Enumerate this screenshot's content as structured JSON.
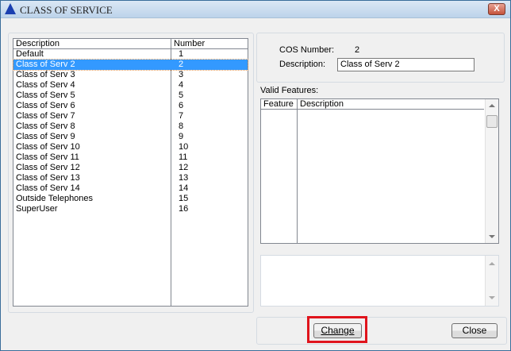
{
  "window": {
    "title": "CLASS OF SERVICE",
    "close_label": "X"
  },
  "cos_list": {
    "columns": [
      "Description",
      "Number"
    ],
    "rows": [
      {
        "description": "Default",
        "number": "1"
      },
      {
        "description": "Class of Serv 2",
        "number": "2",
        "selected": true
      },
      {
        "description": "Class of Serv 3",
        "number": "3"
      },
      {
        "description": "Class of Serv 4",
        "number": "4"
      },
      {
        "description": "Class of Serv 5",
        "number": "5"
      },
      {
        "description": "Class of Serv 6",
        "number": "6"
      },
      {
        "description": "Class of Serv 7",
        "number": "7"
      },
      {
        "description": "Class of Serv 8",
        "number": "8"
      },
      {
        "description": "Class of Serv 9",
        "number": "9"
      },
      {
        "description": "Class of Serv 10",
        "number": "10"
      },
      {
        "description": "Class of Serv 11",
        "number": "11"
      },
      {
        "description": "Class of Serv 12",
        "number": "12"
      },
      {
        "description": "Class of Serv 13",
        "number": "13"
      },
      {
        "description": "Class of Serv 14",
        "number": "14"
      },
      {
        "description": "Outside Telephones",
        "number": "15"
      },
      {
        "description": "SuperUser",
        "number": "16"
      }
    ]
  },
  "details": {
    "cos_number_label": "COS Number:",
    "cos_number_value": "2",
    "description_label": "Description:",
    "description_value": "Class of Serv 2"
  },
  "features": {
    "label": "Valid Features:",
    "columns": [
      "Feature",
      "Description"
    ]
  },
  "buttons": {
    "change": "Change",
    "close": "Close"
  }
}
